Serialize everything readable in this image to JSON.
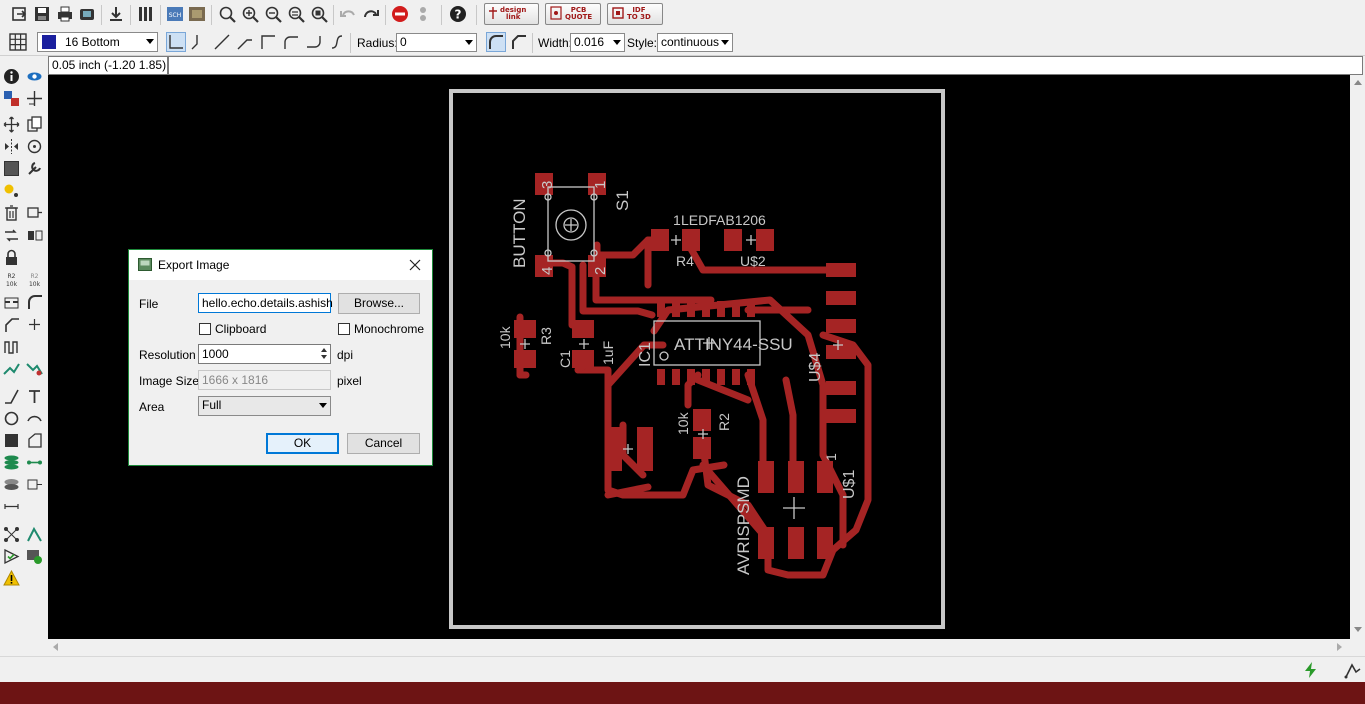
{
  "toolbar_top": {
    "icons": [
      "open-icon",
      "save-icon",
      "print-icon",
      "cam-icon",
      "script-icon",
      "drc-icon",
      "sch-icon",
      "board-icon",
      "zoom-fit-icon",
      "zoom-in-icon",
      "zoom-out-icon",
      "zoom-redraw-icon",
      "zoom-select-icon",
      "undo-icon",
      "redo-icon",
      "stop-icon",
      "go-icon",
      "help-icon"
    ],
    "design_link": [
      "design",
      "link"
    ],
    "pcb_quote": [
      "PCB",
      "QUOTE"
    ],
    "idf_to_3d": [
      "IDF",
      "TO 3D"
    ]
  },
  "toolbar_params": {
    "layer_color": "#1a1f9e",
    "layer": "16 Bottom",
    "radius_label": "Radius:",
    "radius_value": "0",
    "width_label": "Width:",
    "width_value": "0.016",
    "style_label": "Style:",
    "style_value": "continuous"
  },
  "command_bar": {
    "coordinates": "0.05 inch (-1.20 1.85)",
    "command": ""
  },
  "board": {
    "trace_color": "#a52424",
    "outline_color": "#c8c8c8",
    "silk_color": "#c8c8c8",
    "labels": {
      "button": "BUTTON",
      "s1": "S1",
      "pin3": "3",
      "pin1": "1",
      "pin4": "4",
      "pin2": "2",
      "led": "LEDFAB1206",
      "led_prefix": "1",
      "r4": "R4",
      "us2": "U$2",
      "r3_val": "10k",
      "r3": "R3",
      "c1": "C1",
      "c1_val": "1uF",
      "ic1": "IC1",
      "attiny": "ATTINY44-SSU",
      "us4": "U$4",
      "r2_val": "10k",
      "r2": "R2",
      "avr": "AVRISPSMD",
      "us1": "U$1",
      "us1_pin": "1"
    }
  },
  "dialog": {
    "title": "Export Image",
    "file_label": "File",
    "file_value": "hello.echo.details.ashish",
    "browse_label": "Browse...",
    "clipboard_label": "Clipboard",
    "monochrome_label": "Monochrome",
    "resolution_label": "Resolution",
    "resolution_value": "1000",
    "resolution_unit": "dpi",
    "image_size_label": "Image Size",
    "image_size_value": "1666 x 1816",
    "image_size_unit": "pixel",
    "area_label": "Area",
    "area_value": "Full",
    "ok_label": "OK",
    "cancel_label": "Cancel"
  },
  "taskbar_color": "#6d1414"
}
